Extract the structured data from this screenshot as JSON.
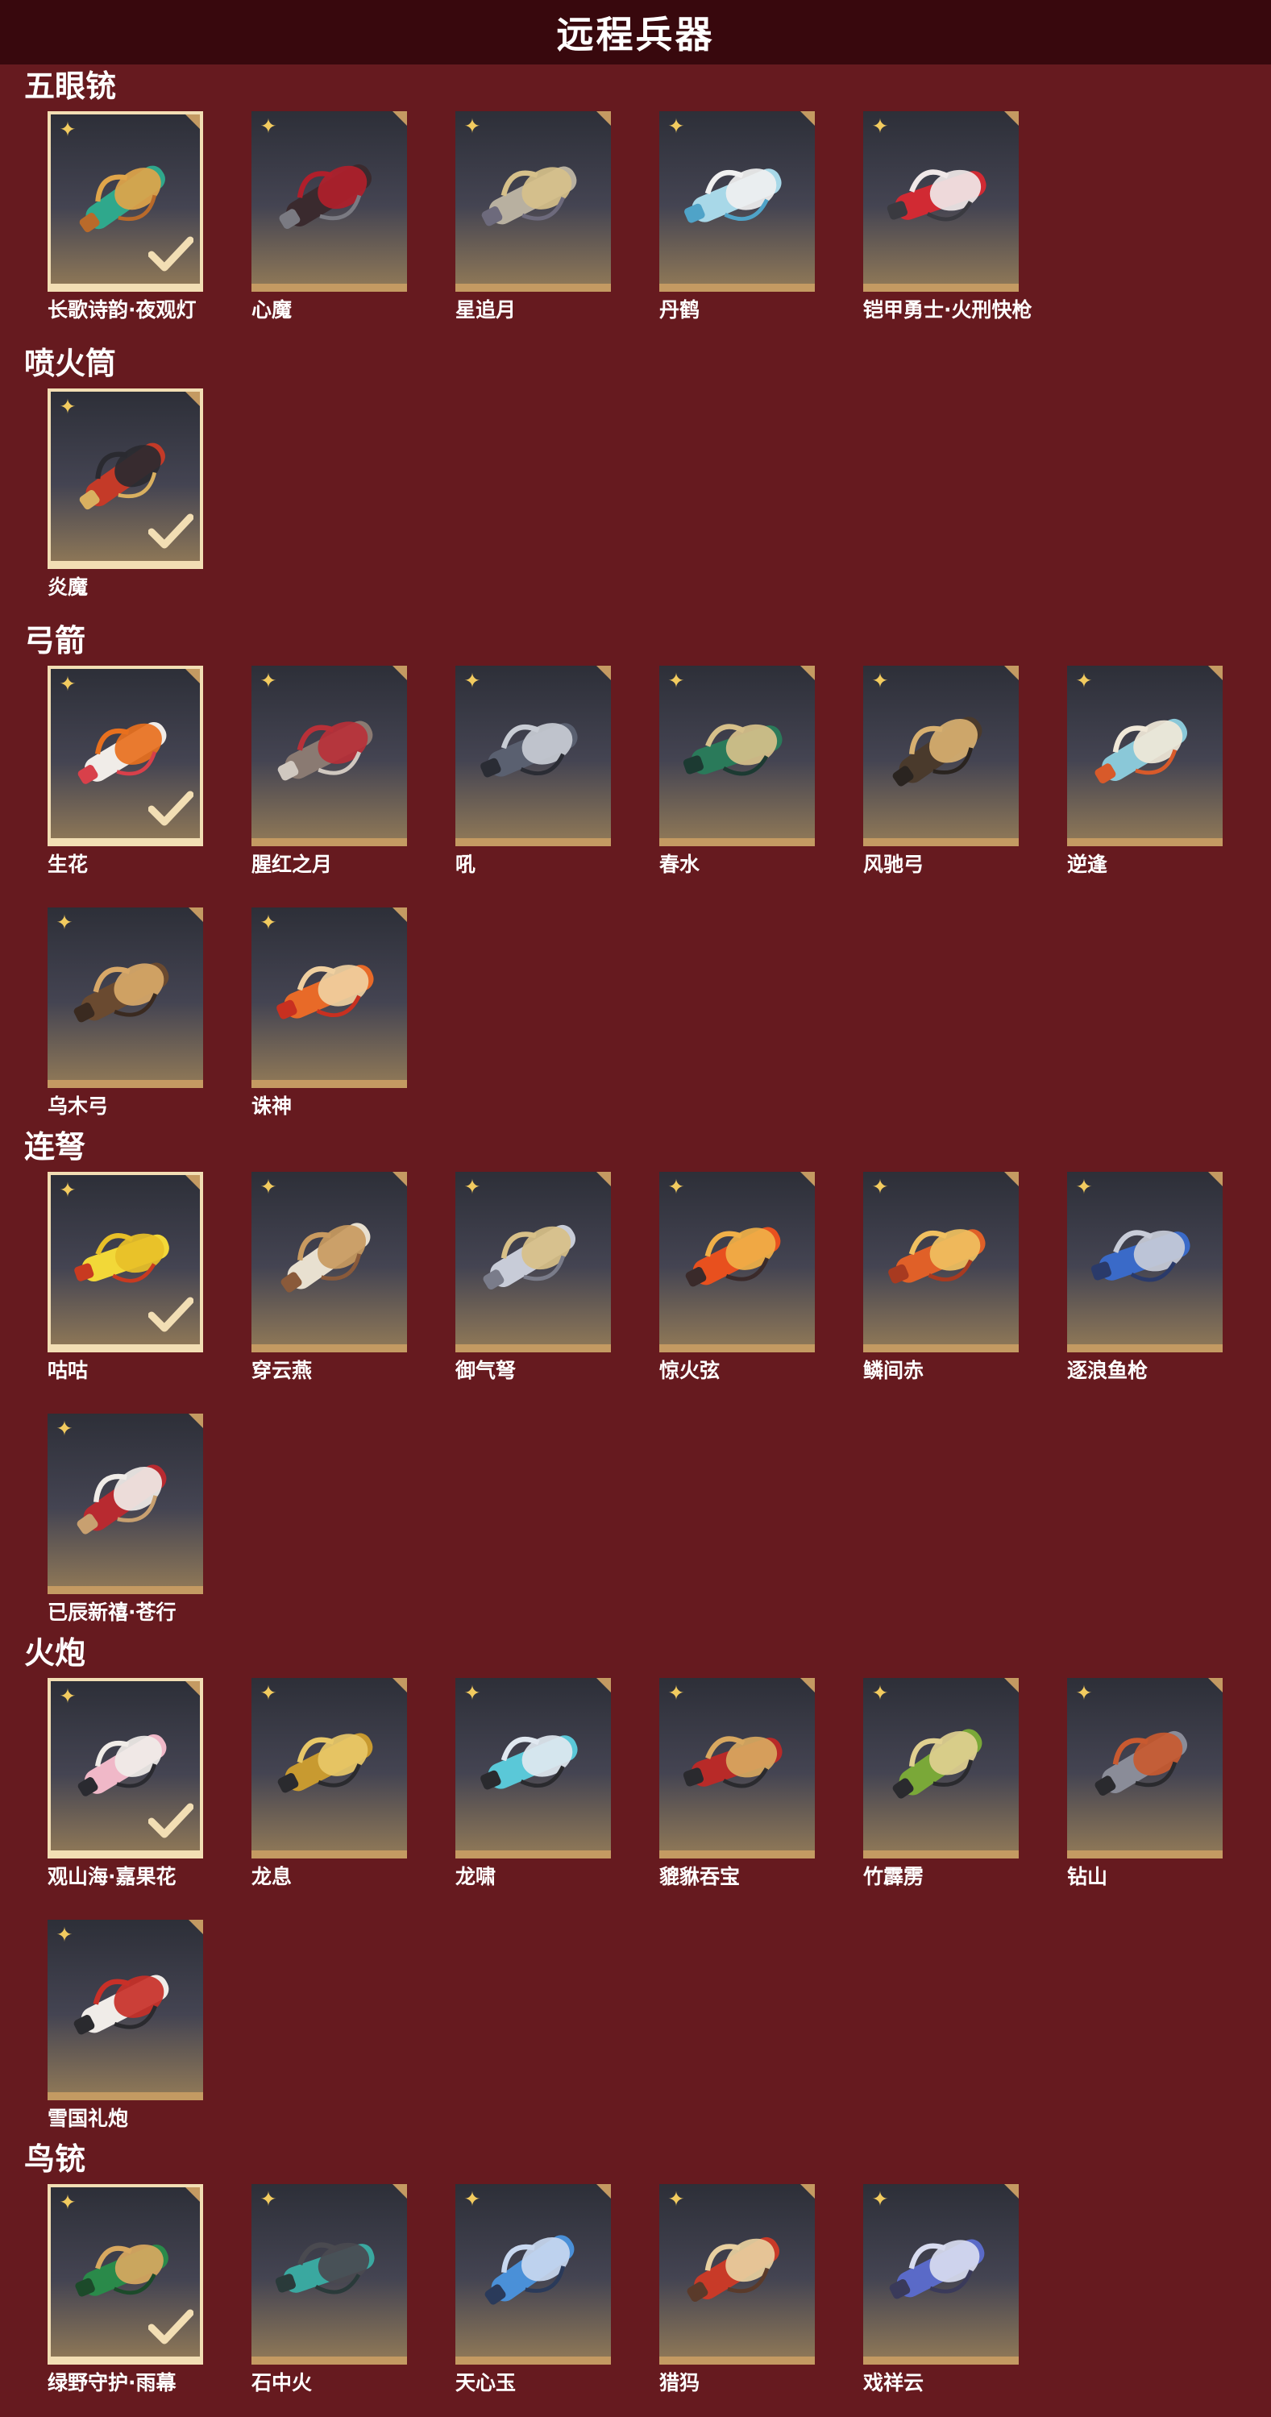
{
  "title": "远程兵器",
  "icons": {
    "rarity": "sparkle-icon",
    "equipped": "checkmark-icon",
    "corner": "corner-tab-icon"
  },
  "colors": {
    "background": "#661a1f",
    "title_bar": "#38080d",
    "card_border_equipped": "#f2deb4",
    "card_bottom": "#c49a62",
    "rarity_star": "#f2cb5f"
  },
  "sections": [
    {
      "name": "五眼铳",
      "items": [
        {
          "label": "长歌诗韵·夜观灯",
          "equipped": true,
          "colors": [
            "#2fa88c",
            "#e0a54a",
            "#b96a2a"
          ]
        },
        {
          "label": "心魔",
          "equipped": false,
          "colors": [
            "#3a2a2e",
            "#b01f2b",
            "#7a7a82"
          ]
        },
        {
          "label": "星追月",
          "equipped": false,
          "colors": [
            "#b8b0a0",
            "#d6c08a",
            "#6d6a7c"
          ]
        },
        {
          "label": "丹鹤",
          "equipped": false,
          "colors": [
            "#a8d8e8",
            "#f0f0f0",
            "#4fa3c8"
          ]
        },
        {
          "label": "铠甲勇士·火刑快枪",
          "equipped": false,
          "colors": [
            "#d12a33",
            "#f0e8e8",
            "#3a3a40"
          ]
        }
      ]
    },
    {
      "name": "喷火筒",
      "items": [
        {
          "label": "炎魔",
          "equipped": true,
          "colors": [
            "#c43a28",
            "#2a2a30",
            "#d9b060"
          ]
        }
      ]
    },
    {
      "name": "弓箭",
      "items": [
        {
          "label": "生花",
          "equipped": true,
          "colors": [
            "#f0ece8",
            "#e8701e",
            "#d8404a"
          ]
        },
        {
          "label": "腥红之月",
          "equipped": false,
          "colors": [
            "#8a7a72",
            "#b83038",
            "#d0c8c0"
          ]
        },
        {
          "label": "吼",
          "equipped": false,
          "colors": [
            "#5a6070",
            "#c8ccd4",
            "#2a2c34"
          ]
        },
        {
          "label": "春水",
          "equipped": false,
          "colors": [
            "#2a7a5a",
            "#d6c08a",
            "#1c3a32"
          ]
        },
        {
          "label": "风驰弓",
          "equipped": false,
          "colors": [
            "#4a3a2c",
            "#d8b070",
            "#2a2420"
          ]
        },
        {
          "label": "逆逢",
          "equipped": false,
          "colors": [
            "#8ac8d8",
            "#f0e8d8",
            "#d85a2a"
          ]
        },
        {
          "label": "乌木弓",
          "equipped": false,
          "colors": [
            "#6a4a30",
            "#d8a868",
            "#3a2a20"
          ]
        },
        {
          "label": "诛神",
          "equipped": false,
          "colors": [
            "#e86a28",
            "#f0d0a0",
            "#c83020"
          ]
        }
      ]
    },
    {
      "name": "连弩",
      "items": [
        {
          "label": "咕咕",
          "equipped": true,
          "colors": [
            "#f2d838",
            "#e8c028",
            "#c83a20"
          ]
        },
        {
          "label": "穿云燕",
          "equipped": false,
          "colors": [
            "#e8e0d0",
            "#c89a60",
            "#8a5a3a"
          ]
        },
        {
          "label": "御气弩",
          "equipped": false,
          "colors": [
            "#c8ccd8",
            "#d8c088",
            "#7a7c8a"
          ]
        },
        {
          "label": "惊火弦",
          "equipped": false,
          "colors": [
            "#e8501e",
            "#f0b048",
            "#3a2a2a"
          ]
        },
        {
          "label": "鳞间赤",
          "equipped": false,
          "colors": [
            "#e06028",
            "#f0c060",
            "#a83a20"
          ]
        },
        {
          "label": "逐浪鱼枪",
          "equipped": false,
          "colors": [
            "#3a6ac8",
            "#c8ccd8",
            "#2a3a6a"
          ]
        },
        {
          "label": "已辰新禧·苍行",
          "equipped": false,
          "colors": [
            "#b82a30",
            "#f0ece8",
            "#c8a070"
          ]
        }
      ]
    },
    {
      "name": "火炮",
      "items": [
        {
          "label": "观山海·嘉果花",
          "equipped": true,
          "colors": [
            "#f0b8c8",
            "#f0ece8",
            "#2a2a30"
          ]
        },
        {
          "label": "龙息",
          "equipped": false,
          "colors": [
            "#c89a30",
            "#e8c868",
            "#2a2a2e"
          ]
        },
        {
          "label": "龙啸",
          "equipped": false,
          "colors": [
            "#5ac8d8",
            "#e0e8f0",
            "#2a2a2e"
          ]
        },
        {
          "label": "貔貅吞宝",
          "equipped": false,
          "colors": [
            "#b82a28",
            "#d8a860",
            "#2a2a2e"
          ]
        },
        {
          "label": "竹霹雳",
          "equipped": false,
          "colors": [
            "#7aa838",
            "#e0d090",
            "#2a2a2e"
          ]
        },
        {
          "label": "钻山",
          "equipped": false,
          "colors": [
            "#8a8c98",
            "#c85a30",
            "#2a2a2e"
          ]
        },
        {
          "label": "雪国礼炮",
          "equipped": false,
          "colors": [
            "#f0ece8",
            "#c83028",
            "#2a2a2e"
          ]
        }
      ]
    },
    {
      "name": "鸟铳",
      "items": [
        {
          "label": "绿野守护·雨幕",
          "equipped": true,
          "colors": [
            "#2a8a4a",
            "#d8a860",
            "#1c4a2a"
          ]
        },
        {
          "label": "石中火",
          "equipped": false,
          "colors": [
            "#3aa8a0",
            "#4a4a50",
            "#2a3a3a"
          ]
        },
        {
          "label": "天心玉",
          "equipped": false,
          "colors": [
            "#4a90d8",
            "#c8d8f0",
            "#2a3a5a"
          ]
        },
        {
          "label": "猎犸",
          "equipped": false,
          "colors": [
            "#c83a28",
            "#e8d0a0",
            "#5a3a2a"
          ]
        },
        {
          "label": "戏祥云",
          "equipped": false,
          "colors": [
            "#5a6ac8",
            "#d8dcf0",
            "#3a3a5a"
          ]
        }
      ]
    }
  ]
}
